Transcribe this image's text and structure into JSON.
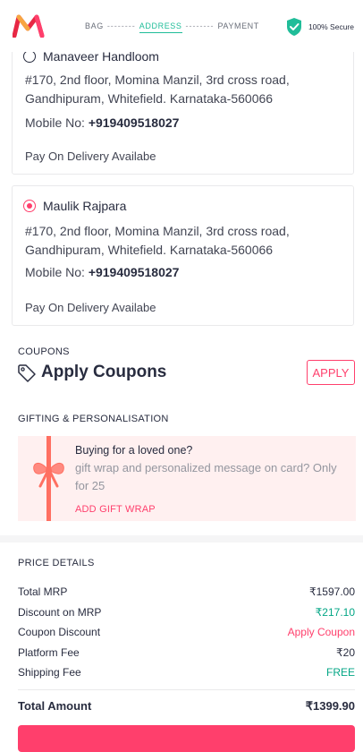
{
  "header": {
    "steps": [
      "BAG",
      "ADDRESS",
      "PAYMENT"
    ],
    "step_separator": "--------",
    "active_step": "ADDRESS",
    "secure_label": "100% Secure"
  },
  "addresses": [
    {
      "name": "Manaveer Handloom",
      "selected": false,
      "address_line1": "#170, 2nd floor, Momina Manzil, 3rd cross road,",
      "address_line2": "Gandhipuram, Whitefield. Karnataka-560066",
      "mobile_label": "Mobile No: ",
      "mobile": "+919409518027",
      "payment_note": "Pay On Delivery Availabe"
    },
    {
      "name": "Maulik Rajpara",
      "selected": true,
      "address_line1": "#170, 2nd floor, Momina Manzil, 3rd cross road,",
      "address_line2": "Gandhipuram, Whitefield. Karnataka-560066",
      "mobile_label": "Mobile No: ",
      "mobile": "+919409518027",
      "payment_note": "Pay On Delivery Availabe"
    }
  ],
  "coupons": {
    "section_title": "COUPONS",
    "heading": "Apply Coupons",
    "button": "APPLY"
  },
  "gifting": {
    "section_title": "GIFTING & PERSONALISATION",
    "heading": "Buying for a loved one?",
    "description": "gift wrap and personalized message on card? Only for 25",
    "link": "ADD GIFT WRAP"
  },
  "price_details": {
    "section_title": "PRICE DETAILS",
    "rows": [
      {
        "label": "Total MRP",
        "value": "₹1597.00"
      },
      {
        "label": "Discount on MRP",
        "value": "₹217.10"
      },
      {
        "label": "Coupon Discount",
        "value": "Apply Coupon"
      },
      {
        "label": "Platform Fee",
        "value": "₹20"
      },
      {
        "label": "Shipping Fee",
        "value": "FREE"
      }
    ],
    "total_label": "Total Amount",
    "total_value": "₹1399.90"
  },
  "colors": {
    "brand_pink": "#ff3f6c",
    "green": "#03a685",
    "teal": "#20bd99"
  }
}
